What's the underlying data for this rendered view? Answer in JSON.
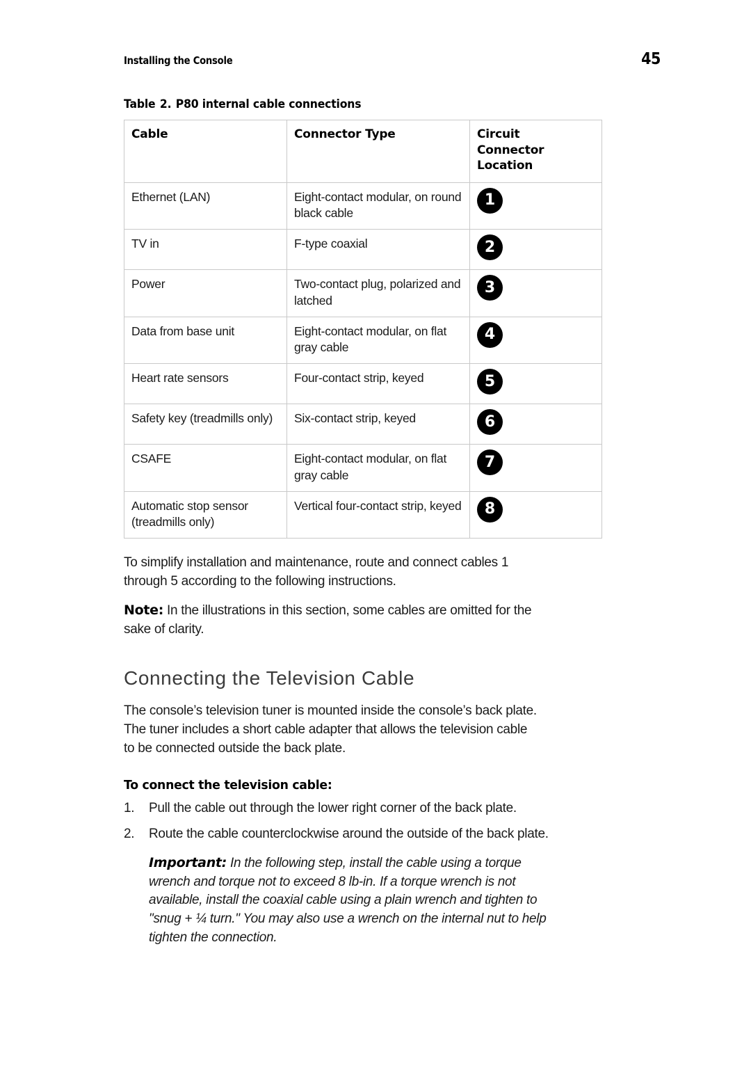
{
  "header": {
    "title": "Installing the Console",
    "page_number": "45"
  },
  "table": {
    "caption_label": "Table",
    "caption_number": "2.",
    "caption_title": "P80 internal cable connections",
    "columns": [
      {
        "label": "Cable"
      },
      {
        "label": "Connector Type"
      },
      {
        "label_line1": "Circuit",
        "label_line2": "Connector",
        "label_line3": "Location"
      }
    ],
    "rows": [
      {
        "cable": "Ethernet (LAN)",
        "connector": "Eight-contact modular, on round black cable",
        "location": "1"
      },
      {
        "cable": "TV in",
        "connector": "F-type coaxial",
        "location": "2"
      },
      {
        "cable": "Power",
        "connector": "Two-contact plug, polarized and latched",
        "location": "3"
      },
      {
        "cable": "Data from base unit",
        "connector": "Eight-contact modular, on flat gray cable",
        "location": "4"
      },
      {
        "cable": "Heart rate sensors",
        "connector": "Four-contact strip, keyed",
        "location": "5"
      },
      {
        "cable": "Safety key (treadmills only)",
        "connector": "Six-contact strip, keyed",
        "location": "6"
      },
      {
        "cable": "CSAFE",
        "connector": "Eight-contact modular, on flat gray cable",
        "location": "7"
      },
      {
        "cable": "Automatic stop sensor (treadmills only)",
        "connector": "Vertical four-contact strip, keyed",
        "location": "8"
      }
    ]
  },
  "body": {
    "intro_paragraph": "To simplify installation and maintenance, route and connect cables 1 through 5 according to the following instructions.",
    "note_label": "Note:",
    "note_text": " In the illustrations in this section, some cables are omitted for the sake of clarity."
  },
  "section": {
    "heading": "Connecting the Television Cable",
    "paragraph": "The console’s television tuner is mounted inside the console’s back plate. The tuner includes a short cable adapter that allows the television cable to be connected outside the back plate."
  },
  "procedure": {
    "heading": "To connect the television cable:",
    "steps": [
      {
        "number": "1.",
        "text": "Pull the cable out through the lower right corner of the back plate."
      },
      {
        "number": "2.",
        "text": "Route the cable counterclockwise around the outside of the back plate."
      }
    ],
    "important_label": "Important:",
    "important_text": " In the following step, install the cable using a torque wrench and torque not to exceed 8 lb-in. If a torque wrench is not available, install the coaxial cable using a plain wrench and tighten to \"snug + ¼ turn.\" You may also use a wrench on the internal nut to help tighten the connection."
  }
}
